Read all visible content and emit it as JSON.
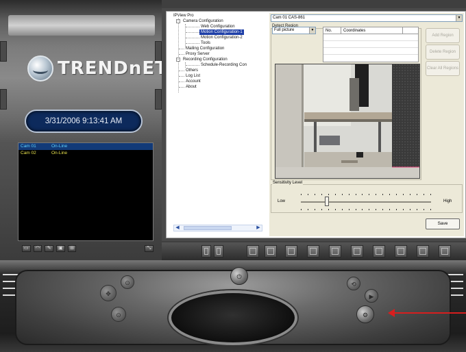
{
  "brand": {
    "logo_text": "TRENDnET"
  },
  "datetime": "3/31/2006 9:13:41 AM",
  "camera_list": [
    {
      "name": "Cam 01",
      "status": "On-Line",
      "selected": true
    },
    {
      "name": "Cam 02",
      "status": "On-Line",
      "selected": false
    }
  ],
  "tree": {
    "root": "IPView Pro",
    "camera_configuration": "Camera Configuration",
    "web_configuration": "Web Configuration",
    "motion_configuration_1": "Motion Configuration-1",
    "motion_configuration_2": "Motion Configuration-2",
    "tools": "Tools",
    "mailing_configuration": "Mailing Configuration",
    "proxy_server": "Proxy Server",
    "recording_configuration": "Recording Configuration",
    "schedule_recording": "Schedule-Recording Con",
    "others": "Others",
    "log_list": "Log List",
    "account": "Account",
    "about": "About"
  },
  "config": {
    "camera_selected": "Cam 01   CAS-861",
    "detect_region_label": "Detect Region",
    "region_selected": "Full picture",
    "table_headers": [
      "No.",
      "Coordinates"
    ],
    "add_region": "Add Region",
    "delete_region": "Delete Region",
    "clear_all_regions": "Clear All Regions",
    "sensitivity_label": "Sensitivity Level",
    "low": "Low",
    "high": "High",
    "sensitivity_level": 0.2,
    "save": "Save"
  },
  "colors": {
    "selection_blue": "#1d3ea7",
    "status_yellow": "#e8e24d",
    "annotation_red": "#d81e1e"
  },
  "icons": [
    "snapshot-icon",
    "record-icon",
    "settings-icon",
    "playback-icon",
    "zoom-icon",
    "exit-icon",
    "split-screen-icon",
    "power-icon",
    "arrow-icon"
  ]
}
